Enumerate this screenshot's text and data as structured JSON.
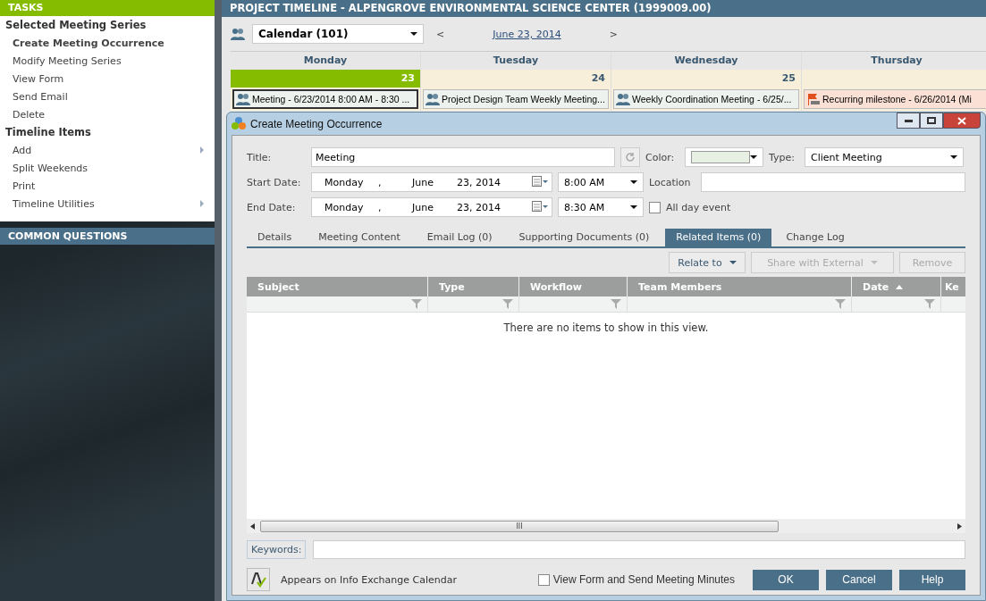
{
  "sidebar": {
    "title": "TASKS",
    "groups": [
      {
        "label": "Selected Meeting Series",
        "items": [
          {
            "label": "Create Meeting Occurrence",
            "selected": true,
            "submenu": false
          },
          {
            "label": "Modify Meeting Series",
            "selected": false,
            "submenu": false
          },
          {
            "label": "View Form",
            "selected": false,
            "submenu": false
          },
          {
            "label": "Send Email",
            "selected": false,
            "submenu": false
          },
          {
            "label": "Delete",
            "selected": false,
            "submenu": false
          }
        ]
      },
      {
        "label": "Timeline Items",
        "items": [
          {
            "label": "Add",
            "selected": false,
            "submenu": true
          },
          {
            "label": "Split Weekends",
            "selected": false,
            "submenu": false
          },
          {
            "label": "Print",
            "selected": false,
            "submenu": false
          },
          {
            "label": "Timeline Utilities",
            "selected": false,
            "submenu": true
          }
        ]
      }
    ],
    "common_questions": "COMMON QUESTIONS"
  },
  "header": {
    "title": "PROJECT TIMELINE - ALPENGROVE ENVIRONMENTAL SCIENCE CENTER (1999009.00)"
  },
  "toolbar": {
    "calendar": "Calendar (101)",
    "prev": "<",
    "date": "June 23, 2014",
    "next": ">"
  },
  "calendar": {
    "days": [
      {
        "name": "Monday",
        "date": "23",
        "selected": true,
        "event": {
          "kind": "meeting",
          "text": "Meeting - 6/23/2014 8:00 AM - 8:30 ...",
          "selected": true
        }
      },
      {
        "name": "Tuesday",
        "date": "24",
        "selected": false,
        "event": {
          "kind": "meeting",
          "text": "Project Design Team Weekly Meeting...",
          "selected": false
        }
      },
      {
        "name": "Wednesday",
        "date": "25",
        "selected": false,
        "event": {
          "kind": "meeting",
          "text": "Weekly Coordination Meeting - 6/25/...",
          "selected": false
        }
      },
      {
        "name": "Thursday",
        "selected": false,
        "event": {
          "kind": "milestone",
          "text": "Recurring milestone - 6/26/2014 (Mi",
          "selected": false
        }
      }
    ]
  },
  "dialog": {
    "title": "Create Meeting Occurrence",
    "title_label": "Title:",
    "title_value": "Meeting",
    "color_label": "Color:",
    "color": "#e8f0e4",
    "type_label": "Type:",
    "type_value": "Client Meeting",
    "start": {
      "label": "Start Date:",
      "weekday": "Monday",
      "sep": ",",
      "month": "June",
      "day": "23, 2014",
      "time": "8:00 AM"
    },
    "location_label": "Location",
    "end": {
      "label": "End Date:",
      "weekday": "Monday",
      "sep": ",",
      "month": "June",
      "day": "23, 2014",
      "time": "8:30 AM"
    },
    "all_day": {
      "label": "All day event",
      "checked": false
    },
    "tabs": [
      {
        "label": "Details",
        "selected": false
      },
      {
        "label": "Meeting Content",
        "selected": false
      },
      {
        "label": "Email Log (0)",
        "selected": false
      },
      {
        "label": "Supporting Documents (0)",
        "selected": false
      },
      {
        "label": "Related Items (0)",
        "selected": true
      },
      {
        "label": "Change Log",
        "selected": false
      }
    ],
    "actions": [
      {
        "label": "Relate to",
        "disabled": false
      },
      {
        "label": "Share with External",
        "disabled": true
      },
      {
        "label": "Remove",
        "disabled": true
      }
    ],
    "grid": {
      "columns": [
        {
          "label": "Subject",
          "sorted": false
        },
        {
          "label": "Type",
          "sorted": false
        },
        {
          "label": "Workflow",
          "sorted": false
        },
        {
          "label": "Team Members",
          "sorted": false
        },
        {
          "label": "Date",
          "sorted": true
        },
        {
          "label": "Ke"
        }
      ],
      "empty": "There are no items to show in this view."
    },
    "scroll_grip": "III",
    "keywords_label": "Keywords:",
    "appears": "Appears on Info Exchange Calendar",
    "minutes": {
      "label": "View Form and Send Meeting Minutes",
      "checked": false
    },
    "buttons": [
      "OK",
      "Cancel",
      "Help"
    ]
  }
}
